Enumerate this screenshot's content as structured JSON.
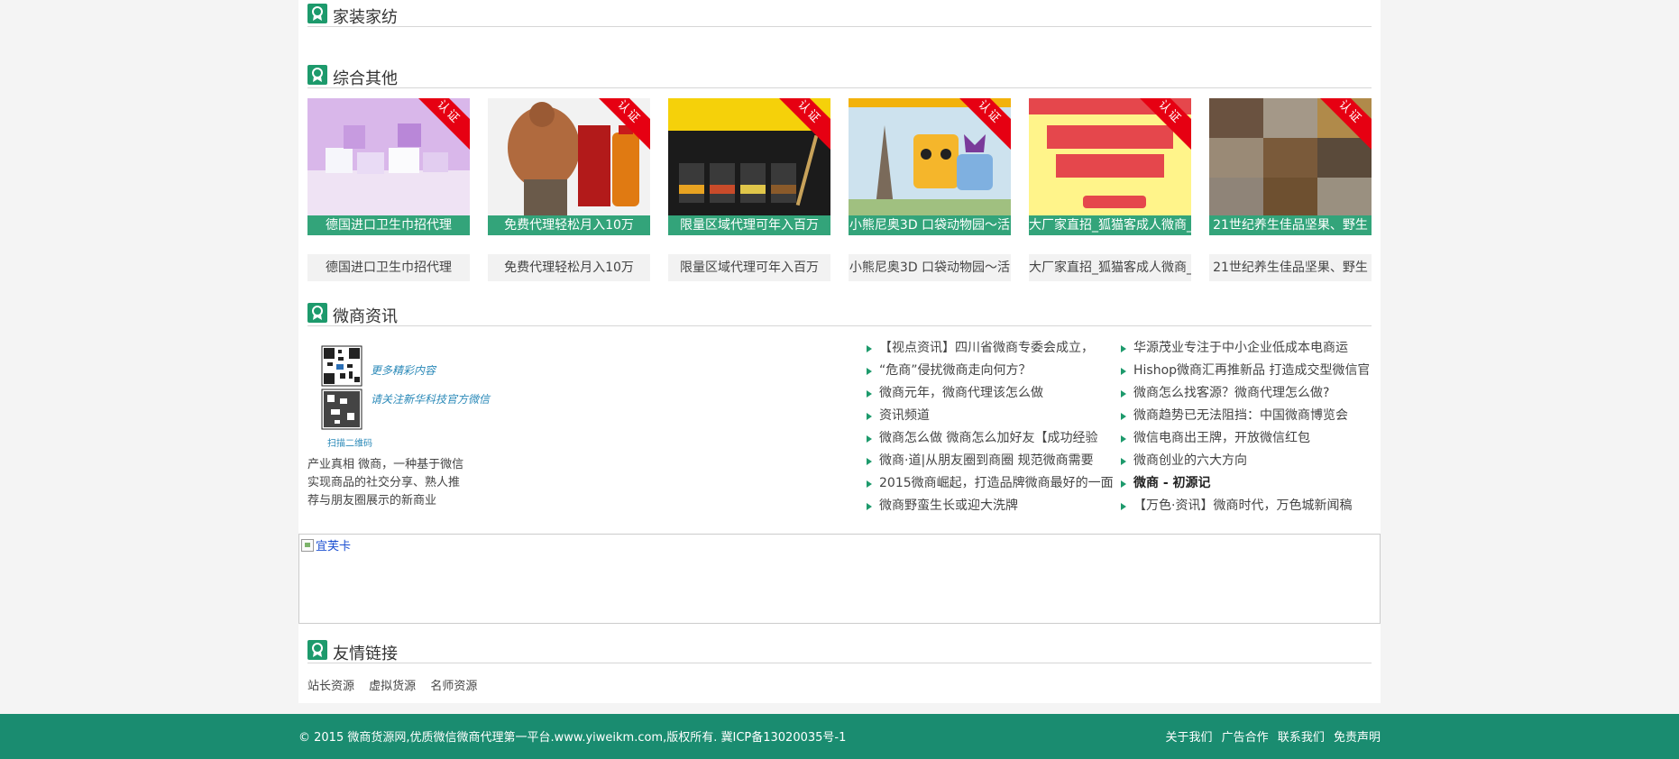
{
  "sections": {
    "home": "家装家纺",
    "other": "综合其他",
    "news": "微商资讯",
    "links": "友情链接"
  },
  "badge": "认证",
  "products": [
    {
      "bar": "德国进口卫生巾招代理",
      "caption": "德国进口卫生巾招代理"
    },
    {
      "bar": "免费代理轻松月入10万",
      "caption": "免费代理轻松月入10万"
    },
    {
      "bar": "限量区域代理可年入百万",
      "caption": "限量区域代理可年入百万"
    },
    {
      "bar": "小熊尼奥3D 口袋动物园～活",
      "caption": "小熊尼奥3D 口袋动物园～活"
    },
    {
      "bar": "大厂家直招_狐猫客成人微商_",
      "caption": "大厂家直招_狐猫客成人微商_"
    },
    {
      "bar": "21世纪养生佳品坚果、野生",
      "caption": "21世纪养生佳品坚果、野生"
    }
  ],
  "qr": {
    "slogan1": "更多精彩内容",
    "slogan2": "请关注新华科技官方微信",
    "scan": "扫描二维码",
    "desc": "产业真相 微商，一种基于微信实现商品的社交分享、熟人推荐与朋友圈展示的新商业"
  },
  "news_left": [
    "【视点资讯】四川省微商专委会成立，",
    "“危商”侵扰微商走向何方？",
    "微商元年，微商代理该怎么做",
    "资讯频道",
    "微商怎么做 微商怎么加好友【成功经验",
    "微商·道|从朋友圈到商圈 规范微商需要",
    "2015微商崛起，打造品牌微商最好的一面",
    "微商野蛮生长或迎大洗牌"
  ],
  "news_right": [
    "华源茂业专注于中小企业低成本电商运",
    "Hishop微商汇再推新品 打造成交型微信官",
    "微商怎么找客源？微商代理怎么做?",
    "微商趋势已无法阻挡：中国微商博览会",
    "微信电商出王牌，开放微信红包",
    "微商创业的六大方向",
    "微商 - 初源记",
    "【万色·资讯】微商时代，万色城新闻稿"
  ],
  "banner_alt": "宜芙卡",
  "friend_links": [
    "站长资源",
    "虚拟货源",
    "名师资源"
  ],
  "footer": {
    "copyright": "© 2015 微商货源网,优质微信微商代理第一平台.www.yiweikm.com,版权所有. 冀ICP备13020035号-1",
    "links": [
      "关于我们",
      "广告合作",
      "联系我们",
      "免责声明"
    ]
  },
  "colors": {
    "accent": "#1d9a6c",
    "footer": "#1a8c70",
    "badge": "#e60012"
  }
}
